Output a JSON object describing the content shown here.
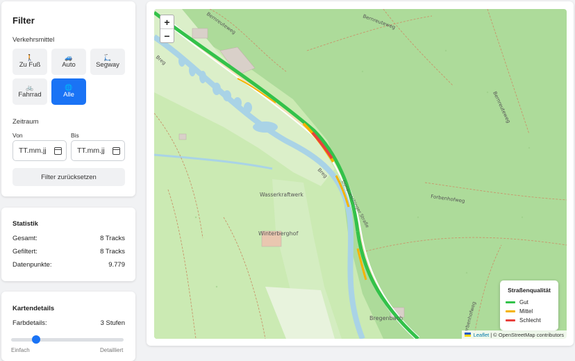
{
  "filter": {
    "title": "Filter",
    "transport_label": "Verkehrsmittel",
    "modes": [
      {
        "icon": "walking-icon",
        "glyph": "🚶",
        "label": "Zu Fuß",
        "active": false
      },
      {
        "icon": "car-icon",
        "glyph": "🚙",
        "label": "Auto",
        "active": false
      },
      {
        "icon": "scooter-icon",
        "glyph": "🛴",
        "label": "Segway",
        "active": false
      },
      {
        "icon": "bicycle-icon",
        "glyph": "🚲",
        "label": "Fahrrad",
        "active": false
      },
      {
        "icon": "globe-icon",
        "glyph": "🌐",
        "label": "Alle",
        "active": true
      }
    ],
    "timespan_label": "Zeitraum",
    "from_label": "Von",
    "to_label": "Bis",
    "from_value": "TT.mm.jj",
    "to_value": "TT.mm.jj",
    "reset_label": "Filter zurücksetzen"
  },
  "stats": {
    "title": "Statistik",
    "rows": [
      {
        "label": "Gesamt:",
        "value": "8 Tracks"
      },
      {
        "label": "Gefiltert:",
        "value": "8 Tracks"
      },
      {
        "label": "Datenpunkte:",
        "value": "9.779"
      }
    ]
  },
  "map_details": {
    "title": "Kartendetails",
    "color_detail_label": "Farbdetails:",
    "color_detail_value": "3 Stufen",
    "slider_level": 0.22,
    "slider_min_label": "Einfach",
    "slider_max_label": "Detailliert"
  },
  "map": {
    "zoom_in": "+",
    "zoom_out": "−",
    "labels": {
      "bernreuteweg_top": "Bernreuteweg",
      "bernreuteweg_mid": "Bernreuteweg",
      "bernreuteweg_right": "Bernreuteweg",
      "forbenhofweg": "Forbenhofweg",
      "forbenhofweg_bottom": "Forbenhofweg",
      "wasserkraftwerk": "Wasserkraftwerk",
      "winterberghof": "Winterberghof",
      "bregenbach": "Bregenbach",
      "breg_1": "Breg",
      "breg_2": "Breg",
      "road": "Donaueschinger Straße"
    },
    "colors": {
      "good": "#33c24a",
      "medium": "#f5b300",
      "bad": "#e8413c"
    }
  },
  "legend": {
    "title": "Straßenqualität",
    "items": [
      {
        "label": "Gut",
        "color": "#33c24a"
      },
      {
        "label": "Mittel",
        "color": "#f5b300"
      },
      {
        "label": "Schlecht",
        "color": "#e8413c"
      }
    ]
  },
  "attribution": {
    "leaflet": "Leaflet",
    "separator": "|",
    "osm": "© OpenStreetMap contributors"
  }
}
